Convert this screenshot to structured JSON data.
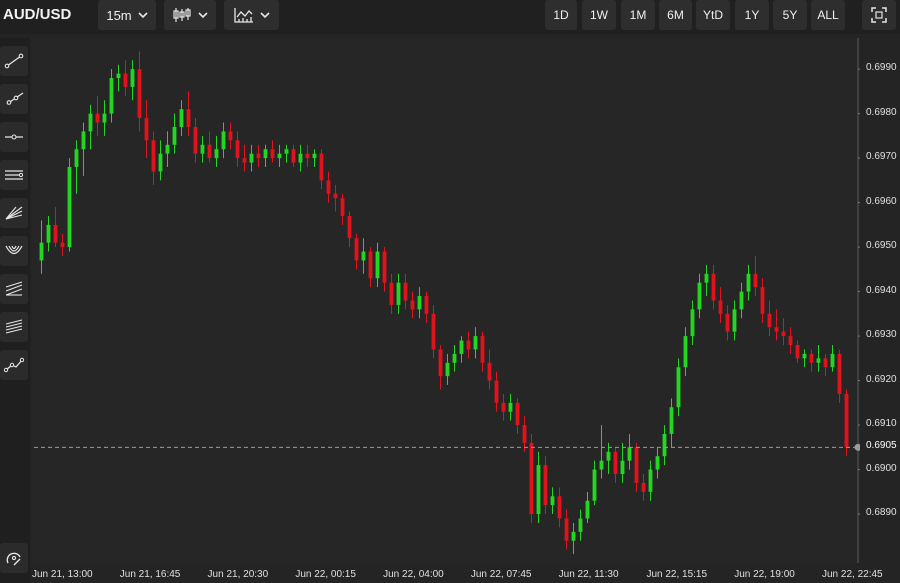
{
  "header": {
    "symbol": "AUD/USD",
    "interval": "15m",
    "chart_type_icon": "candlestick-icon",
    "indicators_icon": "indicators-icon",
    "ranges": [
      "1D",
      "1W",
      "1M",
      "6M",
      "YtD",
      "1Y",
      "5Y",
      "ALL"
    ],
    "fullscreen_icon": "fullscreen-icon"
  },
  "toolbar": {
    "tools": [
      "trendline-icon",
      "ray-icon",
      "horizontal-line-icon",
      "parallel-channel-icon",
      "fan-icon",
      "arc-icon",
      "pitchfork-icon",
      "gann-icon",
      "path-icon"
    ],
    "bottom_tool": "magnet-icon"
  },
  "colors": {
    "up": "#22d622",
    "down": "#e0121c",
    "background": "#262626",
    "grid": "#2f2f2f"
  },
  "chart_data": {
    "type": "candlestick",
    "title": "AUD/USD",
    "interval": "15m",
    "last_price": 0.6905,
    "last_price_label": "0.6905",
    "ylim": [
      0.6879,
      0.6997
    ],
    "y_ticks": [
      "0.6890",
      "0.6900",
      "0.6910",
      "0.6920",
      "0.6930",
      "0.6940",
      "0.6950",
      "0.6960",
      "0.6970",
      "0.6980",
      "0.6990"
    ],
    "x_ticks": [
      "Jun 21, 13:00",
      "Jun 21, 16:45",
      "Jun 21, 20:30",
      "Jun 22, 00:15",
      "Jun 22, 04:00",
      "Jun 22, 07:45",
      "Jun 22, 11:30",
      "Jun 22, 15:15",
      "Jun 22, 19:00",
      "Jun 22, 22:45"
    ],
    "grid": false,
    "candles": [
      [
        0.6947,
        0.6956,
        0.6944,
        0.6951
      ],
      [
        0.6951,
        0.6957,
        0.6949,
        0.6955
      ],
      [
        0.6955,
        0.6959,
        0.695,
        0.6951
      ],
      [
        0.6951,
        0.6953,
        0.6948,
        0.695
      ],
      [
        0.695,
        0.697,
        0.6949,
        0.6968
      ],
      [
        0.6968,
        0.6974,
        0.6962,
        0.6972
      ],
      [
        0.6972,
        0.6978,
        0.6966,
        0.6976
      ],
      [
        0.6976,
        0.6982,
        0.6972,
        0.698
      ],
      [
        0.698,
        0.6984,
        0.6975,
        0.6978
      ],
      [
        0.6978,
        0.6983,
        0.6975,
        0.698
      ],
      [
        0.698,
        0.699,
        0.6978,
        0.6988
      ],
      [
        0.6988,
        0.6991,
        0.6985,
        0.6989
      ],
      [
        0.6989,
        0.6992,
        0.6984,
        0.6986
      ],
      [
        0.6986,
        0.6992,
        0.6983,
        0.699
      ],
      [
        0.699,
        0.6994,
        0.6976,
        0.6979
      ],
      [
        0.6979,
        0.6983,
        0.697,
        0.6974
      ],
      [
        0.6974,
        0.6976,
        0.6964,
        0.6967
      ],
      [
        0.6967,
        0.6974,
        0.6965,
        0.6971
      ],
      [
        0.6971,
        0.6976,
        0.6968,
        0.6973
      ],
      [
        0.6973,
        0.698,
        0.6971,
        0.6977
      ],
      [
        0.6977,
        0.6983,
        0.6975,
        0.6981
      ],
      [
        0.6981,
        0.6985,
        0.6975,
        0.6977
      ],
      [
        0.6977,
        0.6979,
        0.6969,
        0.6971
      ],
      [
        0.6971,
        0.6975,
        0.6969,
        0.6973
      ],
      [
        0.6973,
        0.6976,
        0.6969,
        0.697
      ],
      [
        0.697,
        0.6975,
        0.6968,
        0.6972
      ],
      [
        0.6972,
        0.6978,
        0.697,
        0.6976
      ],
      [
        0.6976,
        0.6978,
        0.6972,
        0.6974
      ],
      [
        0.6974,
        0.6976,
        0.6968,
        0.697
      ],
      [
        0.697,
        0.6973,
        0.6967,
        0.6969
      ],
      [
        0.6969,
        0.6973,
        0.6967,
        0.6971
      ],
      [
        0.6971,
        0.6973,
        0.6968,
        0.697
      ],
      [
        0.697,
        0.6973,
        0.6968,
        0.6972
      ],
      [
        0.6972,
        0.6974,
        0.6969,
        0.697
      ],
      [
        0.697,
        0.6973,
        0.6968,
        0.6971
      ],
      [
        0.6971,
        0.6973,
        0.6969,
        0.6972
      ],
      [
        0.6972,
        0.6973,
        0.6968,
        0.6969
      ],
      [
        0.6969,
        0.6973,
        0.6967,
        0.6971
      ],
      [
        0.6971,
        0.6973,
        0.6968,
        0.697
      ],
      [
        0.697,
        0.6972,
        0.6968,
        0.6971
      ],
      [
        0.6971,
        0.6972,
        0.6963,
        0.6965
      ],
      [
        0.6965,
        0.6967,
        0.696,
        0.6962
      ],
      [
        0.6962,
        0.6964,
        0.6958,
        0.6961
      ],
      [
        0.6961,
        0.6962,
        0.6955,
        0.6957
      ],
      [
        0.6957,
        0.6958,
        0.695,
        0.6952
      ],
      [
        0.6952,
        0.6953,
        0.6945,
        0.6947
      ],
      [
        0.6947,
        0.6952,
        0.6944,
        0.6949
      ],
      [
        0.6949,
        0.695,
        0.6941,
        0.6943
      ],
      [
        0.6943,
        0.6951,
        0.6941,
        0.6949
      ],
      [
        0.6949,
        0.695,
        0.694,
        0.6942
      ],
      [
        0.6942,
        0.6944,
        0.6935,
        0.6937
      ],
      [
        0.6937,
        0.6944,
        0.6935,
        0.6942
      ],
      [
        0.6942,
        0.6944,
        0.6936,
        0.6938
      ],
      [
        0.6938,
        0.694,
        0.6934,
        0.6936
      ],
      [
        0.6936,
        0.6941,
        0.6934,
        0.6939
      ],
      [
        0.6939,
        0.694,
        0.6933,
        0.6935
      ],
      [
        0.6935,
        0.6937,
        0.6925,
        0.6927
      ],
      [
        0.6927,
        0.6928,
        0.6918,
        0.6921
      ],
      [
        0.6921,
        0.6926,
        0.6919,
        0.6924
      ],
      [
        0.6924,
        0.6928,
        0.6922,
        0.6926
      ],
      [
        0.6926,
        0.693,
        0.6924,
        0.6929
      ],
      [
        0.6929,
        0.6931,
        0.6925,
        0.6927
      ],
      [
        0.6927,
        0.6932,
        0.6925,
        0.693
      ],
      [
        0.693,
        0.6931,
        0.6922,
        0.6924
      ],
      [
        0.6924,
        0.6927,
        0.6918,
        0.692
      ],
      [
        0.692,
        0.6922,
        0.6913,
        0.6915
      ],
      [
        0.6915,
        0.6917,
        0.6911,
        0.6913
      ],
      [
        0.6913,
        0.6917,
        0.6911,
        0.6915
      ],
      [
        0.6915,
        0.6916,
        0.6908,
        0.691
      ],
      [
        0.691,
        0.6912,
        0.6904,
        0.6906
      ],
      [
        0.6906,
        0.6908,
        0.6888,
        0.689
      ],
      [
        0.689,
        0.6904,
        0.6888,
        0.6901
      ],
      [
        0.6901,
        0.6903,
        0.689,
        0.6892
      ],
      [
        0.6892,
        0.6896,
        0.689,
        0.6894
      ],
      [
        0.6894,
        0.6896,
        0.6887,
        0.6889
      ],
      [
        0.6889,
        0.6891,
        0.6882,
        0.6884
      ],
      [
        0.6884,
        0.6888,
        0.6881,
        0.6886
      ],
      [
        0.6886,
        0.6891,
        0.6884,
        0.6889
      ],
      [
        0.6889,
        0.6895,
        0.6888,
        0.6893
      ],
      [
        0.6893,
        0.6902,
        0.6892,
        0.69
      ],
      [
        0.69,
        0.691,
        0.6898,
        0.6902
      ],
      [
        0.6902,
        0.6906,
        0.6899,
        0.6904
      ],
      [
        0.6904,
        0.6905,
        0.6897,
        0.6899
      ],
      [
        0.6899,
        0.6906,
        0.6897,
        0.6902
      ],
      [
        0.6902,
        0.6908,
        0.69,
        0.6905
      ],
      [
        0.6905,
        0.6906,
        0.6895,
        0.6897
      ],
      [
        0.6897,
        0.6899,
        0.6893,
        0.6895
      ],
      [
        0.6895,
        0.6902,
        0.6893,
        0.69
      ],
      [
        0.69,
        0.6905,
        0.6898,
        0.6903
      ],
      [
        0.6903,
        0.691,
        0.6901,
        0.6908
      ],
      [
        0.6908,
        0.6916,
        0.6905,
        0.6914
      ],
      [
        0.6914,
        0.6925,
        0.6912,
        0.6923
      ],
      [
        0.6923,
        0.6932,
        0.6921,
        0.693
      ],
      [
        0.693,
        0.6938,
        0.6928,
        0.6936
      ],
      [
        0.6936,
        0.6944,
        0.6934,
        0.6942
      ],
      [
        0.6942,
        0.6946,
        0.6939,
        0.6944
      ],
      [
        0.6944,
        0.6946,
        0.6936,
        0.6938
      ],
      [
        0.6938,
        0.6941,
        0.6933,
        0.6935
      ],
      [
        0.6935,
        0.6937,
        0.6929,
        0.6931
      ],
      [
        0.6931,
        0.6938,
        0.6929,
        0.6936
      ],
      [
        0.6936,
        0.6942,
        0.6934,
        0.694
      ],
      [
        0.694,
        0.6946,
        0.6938,
        0.6944
      ],
      [
        0.6944,
        0.6948,
        0.6939,
        0.6941
      ],
      [
        0.6941,
        0.6943,
        0.6933,
        0.6935
      ],
      [
        0.6935,
        0.6938,
        0.693,
        0.6932
      ],
      [
        0.6932,
        0.6936,
        0.6929,
        0.6931
      ],
      [
        0.6931,
        0.6934,
        0.6928,
        0.693
      ],
      [
        0.693,
        0.6932,
        0.6926,
        0.6928
      ],
      [
        0.6928,
        0.6929,
        0.6924,
        0.6925
      ],
      [
        0.6925,
        0.6927,
        0.6923,
        0.6926
      ],
      [
        0.6926,
        0.6927,
        0.6922,
        0.6924
      ],
      [
        0.6924,
        0.6928,
        0.6922,
        0.6925
      ],
      [
        0.6925,
        0.6926,
        0.6921,
        0.6923
      ],
      [
        0.6923,
        0.6928,
        0.6922,
        0.6926
      ],
      [
        0.6926,
        0.6927,
        0.6915,
        0.6917
      ],
      [
        0.6917,
        0.6918,
        0.6903,
        0.6905
      ]
    ]
  }
}
